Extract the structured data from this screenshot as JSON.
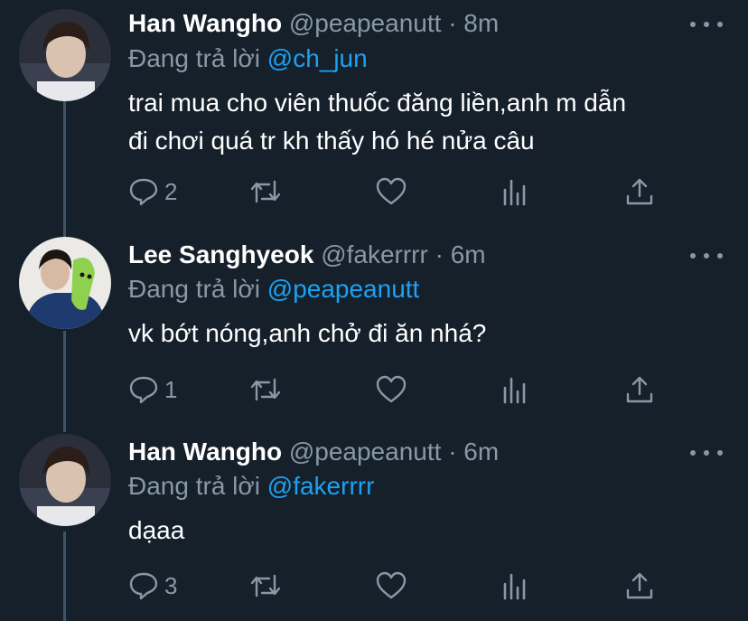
{
  "tweets": [
    {
      "name": "Han Wangho",
      "handle": "@peapeanutt",
      "time": "8m",
      "reply_prefix": "Đang trả lời",
      "reply_to": "@ch_jun",
      "text_lines": [
        "trai mua cho viên thuốc đăng liền,anh m dẫn",
        "đi chơi quá tr kh thấy hó hé nửa câu"
      ],
      "reply_count": "2"
    },
    {
      "name": "Lee Sanghyeok",
      "handle": "@fakerrrr",
      "time": "6m",
      "reply_prefix": "Đang trả lời",
      "reply_to": "@peapeanutt",
      "text_lines": [
        "vk bớt nóng,anh chở đi ăn nhá?"
      ],
      "reply_count": "1"
    },
    {
      "name": "Han Wangho",
      "handle": "@peapeanutt",
      "time": "6m",
      "reply_prefix": "Đang trả lời",
      "reply_to": "@fakerrrr",
      "text_lines": [
        "dạaa"
      ],
      "reply_count": "3"
    }
  ],
  "separator": "·",
  "colors": {
    "background": "#15202b",
    "text": "#ffffff",
    "muted": "#8899a6",
    "accent": "#1da1f2",
    "thread_line": "#3d5466"
  },
  "icons": [
    "reply-icon",
    "retweet-icon",
    "like-icon",
    "analytics-icon",
    "share-icon",
    "more-icon"
  ]
}
